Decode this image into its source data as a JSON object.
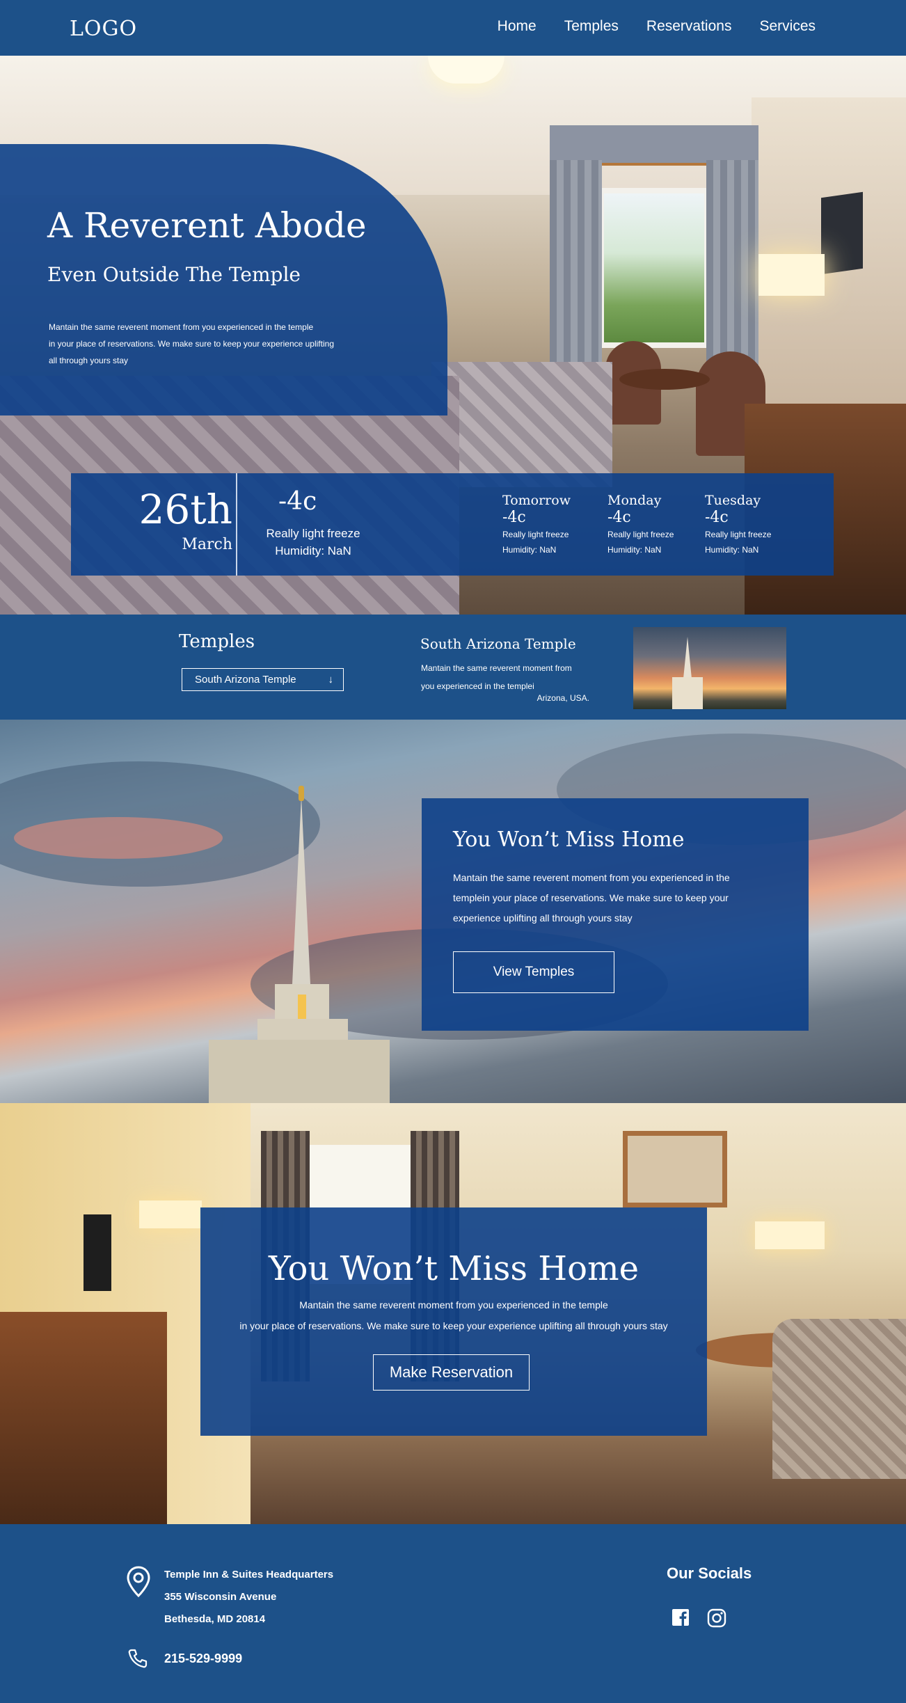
{
  "nav": {
    "logo": "LOGO",
    "links": [
      "Home",
      "Temples",
      "Reservations",
      "Services"
    ]
  },
  "hero": {
    "title": "A Reverent Abode",
    "subtitle": "Even Outside The Temple",
    "description_lines": [
      "Mantain the same reverent moment from you experienced in the temple",
      "in your place of reservations. We make sure to keep your experience uplifting",
      "all through yours stay"
    ]
  },
  "weather": {
    "day": "26th",
    "month": "March",
    "temp": "-4c",
    "desc": "Really light freeze",
    "humidity": "Humidity: NaN",
    "forecast": [
      {
        "day": "Tomorrow",
        "temp": "-4c",
        "desc": "Really light freeze",
        "humidity": "Humidity: NaN"
      },
      {
        "day": "Monday",
        "temp": "-4c",
        "desc": "Really light freeze",
        "humidity": "Humidity: NaN"
      },
      {
        "day": "Tuesday",
        "temp": "-4c",
        "desc": "Really light freeze",
        "humidity": "Humidity: NaN"
      }
    ]
  },
  "temples": {
    "heading": "Temples",
    "selected": "South Arizona Temple",
    "name": "South Arizona Temple",
    "description_lines": [
      "Mantain the same reverent moment from",
      "you experienced in the templei"
    ],
    "location": "Arizona, USA."
  },
  "section_temples": {
    "title": "You Won’t Miss Home",
    "description_lines": [
      "Mantain the same reverent moment from you experienced in the",
      "templein your place of reservations. We make sure to keep your",
      "experience uplifting all through yours stay"
    ],
    "button": "View Temples"
  },
  "section_reservation": {
    "title": "You Won’t Miss Home",
    "description_lines": [
      "Mantain the same reverent moment from you experienced in the temple",
      "in your place of reservations. We make sure to keep your experience uplifting all through yours stay"
    ],
    "button": "Make Reservation"
  },
  "footer": {
    "address_lines": [
      "Temple Inn & Suites Headquarters",
      "355 Wisconsin Avenue",
      "Bethesda, MD 20814"
    ],
    "phone": "215-529-9999",
    "socials_title": "Our Socials",
    "socials": [
      "facebook-icon",
      "instagram-icon"
    ]
  },
  "colors": {
    "primary": "#1d5189",
    "panel": "#0d408a",
    "text": "#ffffff"
  }
}
